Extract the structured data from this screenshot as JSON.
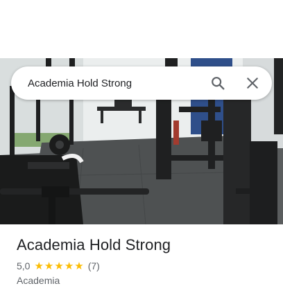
{
  "search": {
    "query": "Academia Hold Strong",
    "search_icon": "search-icon",
    "close_icon": "close-icon"
  },
  "photo": {
    "subject": "gym-interior-photo"
  },
  "place": {
    "name": "Academia Hold Strong",
    "rating": "5,0",
    "stars": 5,
    "review_count": "(7)",
    "category": "Academia"
  },
  "colors": {
    "star": "#fbbc04",
    "title_text": "#202124",
    "secondary_text": "#5f6368"
  }
}
